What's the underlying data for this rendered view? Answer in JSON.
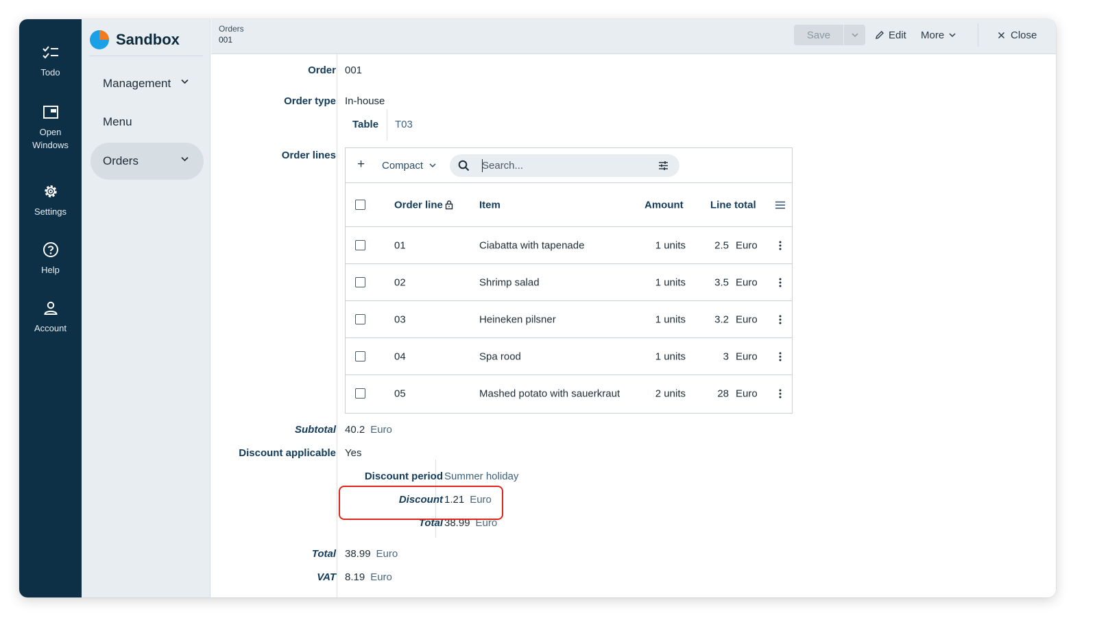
{
  "app": {
    "name": "Sandbox"
  },
  "rail": {
    "items": [
      {
        "label": "Todo",
        "icon": "todo-checklist-icon"
      },
      {
        "label": "Open\nWindows",
        "icon": "open-windows-icon"
      },
      {
        "label": "Settings",
        "icon": "gear-icon"
      },
      {
        "label": "Help",
        "icon": "help-icon"
      },
      {
        "label": "Account",
        "icon": "account-icon"
      }
    ]
  },
  "nav": {
    "items": [
      {
        "label": "Management",
        "expandable": true
      },
      {
        "label": "Menu",
        "expandable": false
      },
      {
        "label": "Orders",
        "expandable": true,
        "active": true
      }
    ]
  },
  "breadcrumb": {
    "section": "Orders",
    "record": "001"
  },
  "toolbar": {
    "save": "Save",
    "edit": "Edit",
    "more": "More",
    "close": "Close"
  },
  "form": {
    "order_label": "Order",
    "order_value": "001",
    "order_type_label": "Order type",
    "order_type_value": "In-house",
    "table_label": "Table",
    "table_value": "T03",
    "order_lines_label": "Order lines",
    "subtotal_label": "Subtotal",
    "subtotal_value": "40.2",
    "subtotal_unit": "Euro",
    "discount_applicable_label": "Discount applicable",
    "discount_applicable_value": "Yes",
    "discount_period_label": "Discount period",
    "discount_period_value": "Summer holiday",
    "discount_label": "Discount",
    "discount_value": "1.21",
    "discount_unit": "Euro",
    "inner_total_label": "Total",
    "inner_total_value": "38.99",
    "inner_total_unit": "Euro",
    "total_label": "Total",
    "total_value": "38.99",
    "total_unit": "Euro",
    "vat_label": "VAT",
    "vat_value": "8.19",
    "vat_unit": "Euro"
  },
  "order_lines": {
    "add": "+",
    "view_mode": "Compact",
    "search_placeholder": "Search...",
    "columns": {
      "line": "Order line",
      "item": "Item",
      "amount": "Amount",
      "total": "Line total"
    },
    "rows": [
      {
        "line": "01",
        "item": "Ciabatta with tapenade",
        "amount": "1 units",
        "total": "2.5",
        "unit": "Euro"
      },
      {
        "line": "02",
        "item": "Shrimp salad",
        "amount": "1 units",
        "total": "3.5",
        "unit": "Euro"
      },
      {
        "line": "03",
        "item": "Heineken pilsner",
        "amount": "1 units",
        "total": "3.2",
        "unit": "Euro"
      },
      {
        "line": "04",
        "item": "Spa rood",
        "amount": "1 units",
        "total": "3",
        "unit": "Euro"
      },
      {
        "line": "05",
        "item": "Mashed potato with sauerkraut",
        "amount": "2 units",
        "total": "28",
        "unit": "Euro"
      }
    ]
  },
  "colors": {
    "rail": "#0d3046",
    "accent": "#1aa0e6",
    "label": "#123a5a",
    "highlight": "#e2231a"
  }
}
